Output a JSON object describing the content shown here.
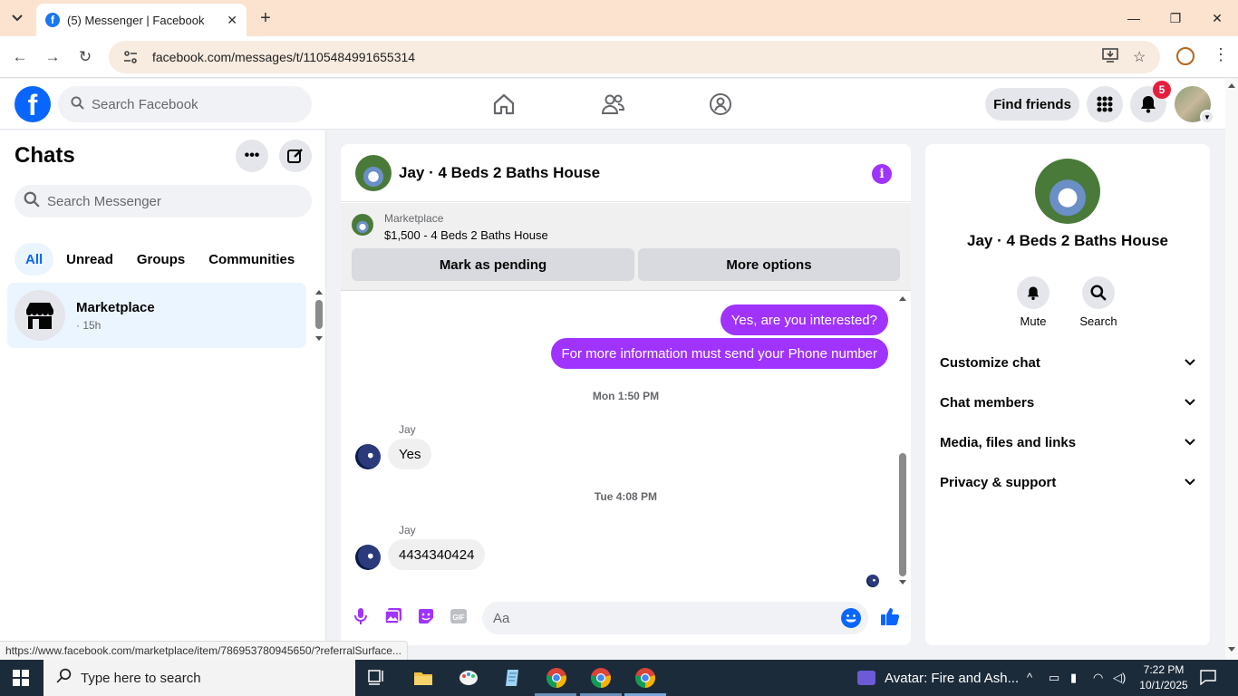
{
  "browser": {
    "tab_title": "(5) Messenger | Facebook",
    "url": "facebook.com/messages/t/1105484991655314",
    "status_url": "https://www.facebook.com/marketplace/item/786953780945650/?referralSurface..."
  },
  "fb": {
    "search_placeholder": "Search Facebook",
    "find_friends": "Find friends",
    "notification_count": "5"
  },
  "left": {
    "title": "Chats",
    "search_placeholder": "Search Messenger",
    "filters": [
      "All",
      "Unread",
      "Groups",
      "Communities"
    ],
    "active_filter": "All",
    "chat": {
      "name": "Marketplace",
      "time": "· 15h"
    }
  },
  "conversation": {
    "title": "Jay · 4 Beds 2 Baths House",
    "marketplace_label": "Marketplace",
    "listing": "$1,500 - 4 Beds 2 Baths House",
    "pending_button": "Mark as pending",
    "options_button": "More options",
    "messages": [
      {
        "kind": "out",
        "text": "Yes, are you interested?"
      },
      {
        "kind": "out",
        "text": "For more information must send your Phone number"
      },
      {
        "kind": "stamp",
        "text": "Mon 1:50 PM"
      },
      {
        "kind": "in",
        "sender": "Jay",
        "text": "Yes"
      },
      {
        "kind": "stamp",
        "text": "Tue 4:08 PM"
      },
      {
        "kind": "in",
        "sender": "Jay",
        "text": "4434340424"
      }
    ],
    "composer_placeholder": "Aa",
    "accent_color": "#a033ff"
  },
  "right": {
    "title": "Jay · 4 Beds 2 Baths House",
    "mute_label": "Mute",
    "search_label": "Search",
    "sections": [
      "Customize chat",
      "Chat members",
      "Media, files and links",
      "Privacy & support"
    ]
  },
  "taskbar": {
    "search_placeholder": "Type here to search",
    "media_title": "Avatar: Fire and Ash...",
    "time": "7:22 PM",
    "date": "10/1/2025"
  }
}
